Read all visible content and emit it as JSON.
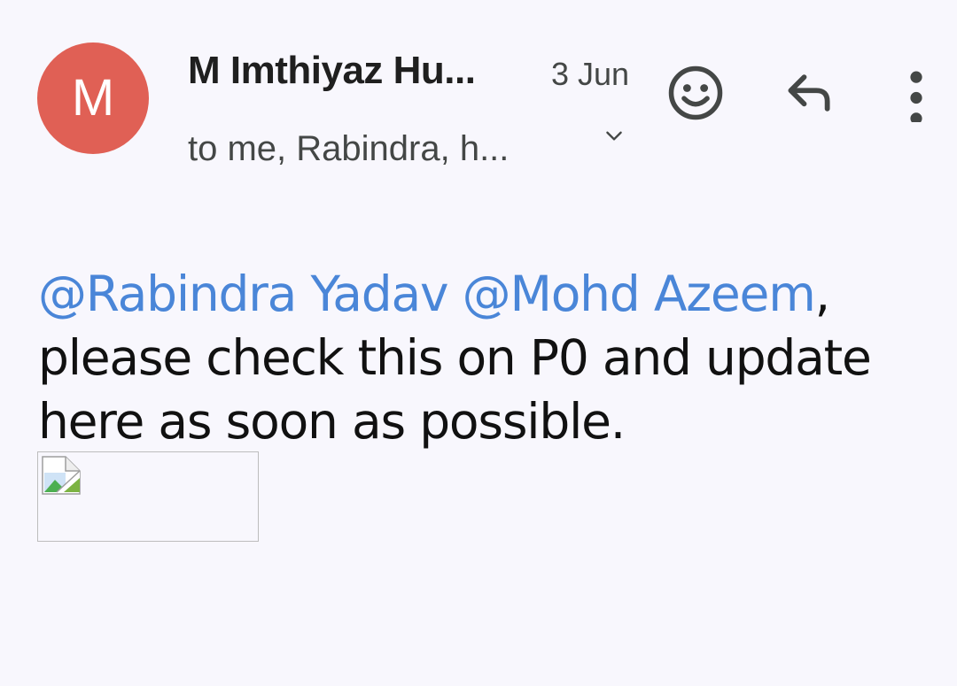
{
  "sender": {
    "avatar_letter": "M",
    "avatar_color": "#e06055",
    "name": "M Imthiyaz Hu...",
    "date": "3 Jun"
  },
  "recipients": {
    "text": "to me, Rabindra, h...",
    "expand_icon": "chevron-down-icon"
  },
  "actions": {
    "emoji_icon": "emoji-reaction-icon",
    "reply_icon": "reply-icon",
    "more_icon": "more-vert-icon"
  },
  "body": {
    "mention_1": "@Rabindra Yadav",
    "space": " ",
    "mention_2": "@Mohd Azeem",
    "after_mentions": ",",
    "message": "please check this on P0 and update here as soon as possible.",
    "mention_color": "#4a86d8"
  },
  "attachment": {
    "type": "broken-image-icon"
  }
}
